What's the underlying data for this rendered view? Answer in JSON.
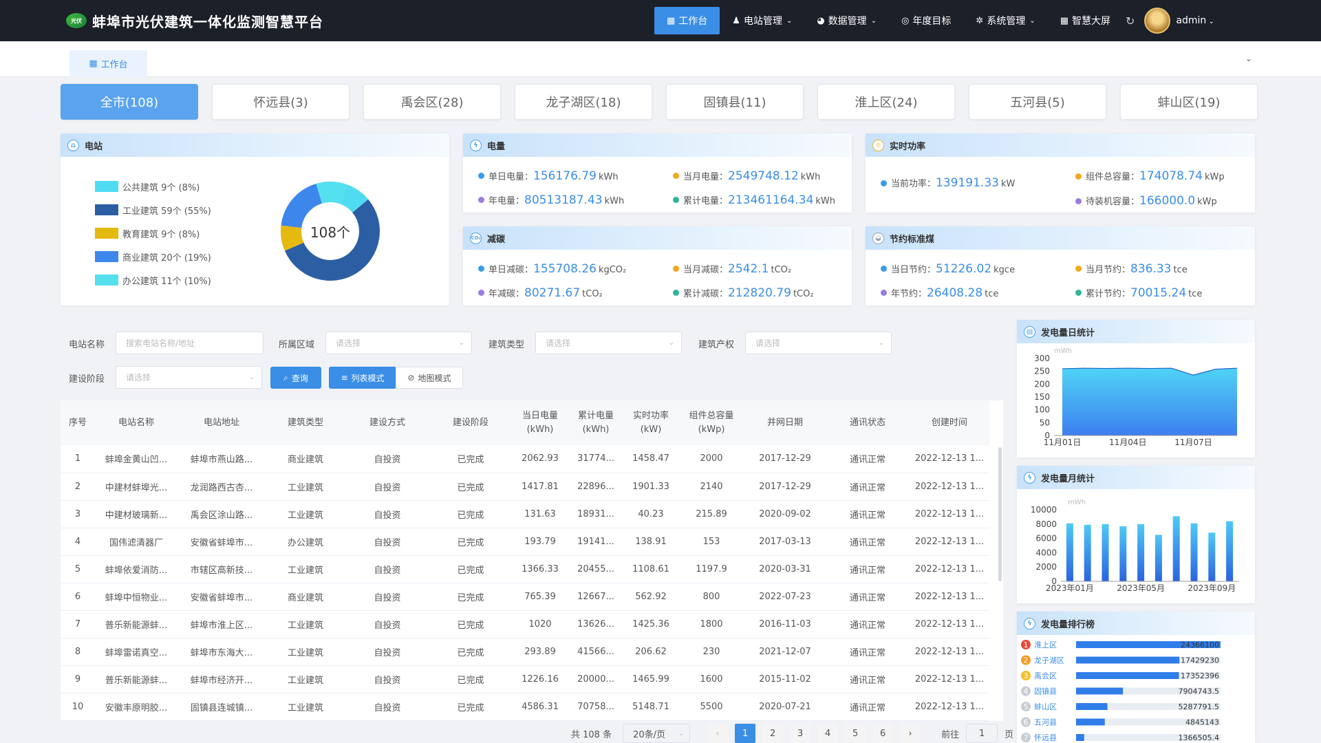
{
  "app": {
    "title": "蚌埠市光伏建筑一体化监测智慧平台",
    "logo_text": "光伏"
  },
  "nav": [
    {
      "label": "工作台",
      "icon": "▦",
      "active": true,
      "dropdown": false
    },
    {
      "label": "电站管理",
      "icon": "♟",
      "active": false,
      "dropdown": true
    },
    {
      "label": "数据管理",
      "icon": "◕",
      "active": false,
      "dropdown": true
    },
    {
      "label": "年度目标",
      "icon": "◎",
      "active": false,
      "dropdown": false
    },
    {
      "label": "系统管理",
      "icon": "✲",
      "active": false,
      "dropdown": true
    },
    {
      "label": "智慧大屏",
      "icon": "▦",
      "active": false,
      "dropdown": false
    }
  ],
  "user": {
    "name": "admin"
  },
  "tabs": [
    {
      "label": "工作台"
    }
  ],
  "regions": [
    {
      "label": "全市(108)",
      "active": true
    },
    {
      "label": "怀远县(3)",
      "active": false
    },
    {
      "label": "禹会区(28)",
      "active": false
    },
    {
      "label": "龙子湖区(18)",
      "active": false
    },
    {
      "label": "固镇县(11)",
      "active": false
    },
    {
      "label": "淮上区(24)",
      "active": false
    },
    {
      "label": "五河县(5)",
      "active": false
    },
    {
      "label": "蚌山区(19)",
      "active": false
    }
  ],
  "station": {
    "title": "电站",
    "total_label": "108个",
    "types": [
      {
        "label": "公共建筑 9个 (8%)",
        "value": 9,
        "color": "#4fdcf2"
      },
      {
        "label": "工业建筑 59个 (55%)",
        "value": 59,
        "color": "#2c5ea3"
      },
      {
        "label": "教育建筑 9个 (8%)",
        "value": 9,
        "color": "#e4b910"
      },
      {
        "label": "商业建筑 20个 (19%)",
        "value": 20,
        "color": "#3d86ec"
      },
      {
        "label": "办公建筑 11个 (10%)",
        "value": 11,
        "color": "#55e0f0"
      }
    ]
  },
  "energy": {
    "title": "电量",
    "items": [
      {
        "label": "单日电量：",
        "value": "156176.79",
        "unit": "kWh",
        "dot": "#3a9ce8"
      },
      {
        "label": "当月电量：",
        "value": "2549748.12",
        "unit": "kWh",
        "dot": "#f0a91b"
      },
      {
        "label": "年电量：",
        "value": "80513187.43",
        "unit": "kWh",
        "dot": "#9b7be3"
      },
      {
        "label": "累计电量：",
        "value": "213461164.34",
        "unit": "kWh",
        "dot": "#2eb59a"
      }
    ]
  },
  "power": {
    "title": "实时功率",
    "items": [
      {
        "label": "当前功率：",
        "value": "139191.33",
        "unit": "kW",
        "dot": "#3a9ce8"
      },
      {
        "label": "组件总容量：",
        "value": "174078.74",
        "unit": "kWp",
        "dot": "#f0a91b"
      },
      {
        "label": "待装机容量：",
        "value": "166000.0",
        "unit": "kWp",
        "dot": "#9b7be3"
      }
    ]
  },
  "carbon": {
    "title": "减碳",
    "items": [
      {
        "label": "单日减碳：",
        "value": "155708.26",
        "unit": "kgCO₂",
        "dot": "#3a9ce8"
      },
      {
        "label": "当月减碳：",
        "value": "2542.1",
        "unit": "tCO₂",
        "dot": "#f0a91b"
      },
      {
        "label": "年减碳：",
        "value": "80271.67",
        "unit": "tCO₂",
        "dot": "#9b7be3"
      },
      {
        "label": "累计减碳：",
        "value": "212820.79",
        "unit": "tCO₂",
        "dot": "#2eb59a"
      }
    ]
  },
  "coal": {
    "title": "节约标准煤",
    "items": [
      {
        "label": "当日节约：",
        "value": "51226.02",
        "unit": "kgce",
        "dot": "#3a9ce8"
      },
      {
        "label": "当月节约：",
        "value": "836.33",
        "unit": "tce",
        "dot": "#f0a91b"
      },
      {
        "label": "年节约：",
        "value": "26408.28",
        "unit": "tce",
        "dot": "#9b7be3"
      },
      {
        "label": "累计节约：",
        "value": "70015.24",
        "unit": "tce",
        "dot": "#2eb59a"
      }
    ]
  },
  "filters": {
    "name_label": "电站名称",
    "name_placeholder": "搜索电站名称/地址",
    "area_label": "所属区域",
    "area_placeholder": "请选择",
    "type_label": "建筑类型",
    "type_placeholder": "请选择",
    "owner_label": "建筑产权",
    "owner_placeholder": "请选择",
    "stage_label": "建设阶段",
    "stage_placeholder": "请选择",
    "query_btn": "查询",
    "list_btn": "列表模式",
    "map_btn": "地图模式"
  },
  "table": {
    "headers": [
      [
        "序号"
      ],
      [
        "电站名称"
      ],
      [
        "电站地址"
      ],
      [
        "建筑类型"
      ],
      [
        "建设方式"
      ],
      [
        "建设阶段"
      ],
      [
        "当日电量",
        "(kWh)"
      ],
      [
        "累计电量",
        "(kWh)"
      ],
      [
        "实时功率",
        "(kW)"
      ],
      [
        "组件总容量",
        "(kWp)"
      ],
      [
        "并网日期"
      ],
      [
        "通讯状态"
      ],
      [
        "创建时间"
      ]
    ],
    "rows": [
      [
        "1",
        "蚌埠金黄山凹...",
        "蚌埠市燕山路...",
        "商业建筑",
        "自投资",
        "已完成",
        "2062.93",
        "31774...",
        "1458.47",
        "2000",
        "2017-12-29",
        "通讯正常",
        "2022-12-13 1..."
      ],
      [
        "2",
        "中建材蚌埠光...",
        "龙润路西古杏...",
        "工业建筑",
        "自投资",
        "已完成",
        "1417.81",
        "22896...",
        "1901.33",
        "2140",
        "2017-12-29",
        "通讯正常",
        "2022-12-13 1..."
      ],
      [
        "3",
        "中建材玻璃新...",
        "禹会区涂山路...",
        "工业建筑",
        "自投资",
        "已完成",
        "131.63",
        "18931...",
        "40.23",
        "215.89",
        "2020-09-02",
        "通讯正常",
        "2022-12-13 1..."
      ],
      [
        "4",
        "国伟滤清器厂",
        "安徽省蚌埠市...",
        "办公建筑",
        "自投资",
        "已完成",
        "193.79",
        "19141...",
        "138.91",
        "153",
        "2017-03-13",
        "通讯正常",
        "2022-12-13 1..."
      ],
      [
        "5",
        "蚌埠依爱消防...",
        "市辖区高新技...",
        "工业建筑",
        "自投资",
        "已完成",
        "1366.33",
        "20455...",
        "1108.61",
        "1197.9",
        "2020-03-31",
        "通讯正常",
        "2022-12-13 1..."
      ],
      [
        "6",
        "蚌埠中恒物业...",
        "安徽省蚌埠市...",
        "商业建筑",
        "自投资",
        "已完成",
        "765.39",
        "12667...",
        "562.92",
        "800",
        "2022-07-23",
        "通讯正常",
        "2022-12-13 1..."
      ],
      [
        "7",
        "普乐新能源蚌...",
        "蚌埠市淮上区...",
        "工业建筑",
        "自投资",
        "已完成",
        "1020",
        "13626...",
        "1425.36",
        "1800",
        "2016-11-03",
        "通讯正常",
        "2022-12-13 1..."
      ],
      [
        "8",
        "蚌埠雷诺真空...",
        "蚌埠市东海大...",
        "工业建筑",
        "自投资",
        "已完成",
        "293.89",
        "41566...",
        "206.62",
        "230",
        "2021-12-07",
        "通讯正常",
        "2022-12-13 1..."
      ],
      [
        "9",
        "普乐新能源蚌...",
        "蚌埠市经济开...",
        "工业建筑",
        "自投资",
        "已完成",
        "1226.16",
        "20000...",
        "1465.99",
        "1600",
        "2015-11-02",
        "通讯正常",
        "2022-12-13 1..."
      ],
      [
        "10",
        "安徽丰原明胶...",
        "固镇县连城镇...",
        "工业建筑",
        "自投资",
        "已完成",
        "4586.31",
        "70758...",
        "5148.71",
        "5500",
        "2020-07-21",
        "通讯正常",
        "2022-12-13 1..."
      ]
    ]
  },
  "pagination": {
    "total": "共 108 条",
    "page_size": "20条/页",
    "pages": [
      "1",
      "2",
      "3",
      "4",
      "5",
      "6"
    ],
    "current": "1",
    "prev": "‹",
    "next": "›",
    "goto_label": "前往",
    "goto_value": "1",
    "goto_unit": "页"
  },
  "chart_data": [
    {
      "type": "area",
      "title": "发电量日统计",
      "ylabel": "mWh",
      "ylim": [
        0,
        300
      ],
      "yticks": [
        0,
        50,
        100,
        150,
        200,
        250,
        300
      ],
      "xtick_labels": [
        "11月01日",
        "11月04日",
        "11月07日"
      ],
      "x": [
        "11月01日",
        "11月02日",
        "11月03日",
        "11月04日",
        "11月05日",
        "11月06日",
        "11月07日",
        "11月08日",
        "11月09日"
      ],
      "values": [
        260,
        262,
        261,
        262,
        261,
        262,
        235,
        258,
        262
      ],
      "color": "#3d7ff0"
    },
    {
      "type": "bar",
      "title": "发电量月统计",
      "ylabel": "mWh",
      "ylim": [
        0,
        10000
      ],
      "yticks": [
        0,
        2000,
        4000,
        6000,
        8000,
        10000
      ],
      "xtick_labels": [
        "2023年01月",
        "2023年05月",
        "2023年09月"
      ],
      "categories": [
        "2023年01月",
        "2023年02月",
        "2023年03月",
        "2023年04月",
        "2023年05月",
        "2023年06月",
        "2023年07月",
        "2023年08月",
        "2023年09月",
        "2023年10月"
      ],
      "values": [
        8100,
        7900,
        8000,
        7700,
        8000,
        6500,
        9100,
        8100,
        6800,
        8400
      ],
      "color": "#2a63e0"
    },
    {
      "type": "bar",
      "title": "发电量排行榜",
      "categories": [
        "淮上区",
        "龙子湖区",
        "禹会区",
        "固镇县",
        "蚌山区",
        "五河县",
        "怀远县"
      ],
      "values": [
        24366100,
        17429230,
        17352396,
        7904743.5,
        5287791.5,
        4845143,
        1366505.4
      ],
      "labels": [
        "24366100",
        "17429230",
        "17352396",
        "7904743.5",
        "5287791.5",
        "4845143",
        "1366505.4"
      ],
      "rank_colors": [
        "#e84a3a",
        "#f59a23",
        "#f4c025",
        "#c8ccd3",
        "#c8ccd3",
        "#c8ccd3",
        "#c8ccd3"
      ],
      "bar_color": "#2f7de8"
    }
  ]
}
